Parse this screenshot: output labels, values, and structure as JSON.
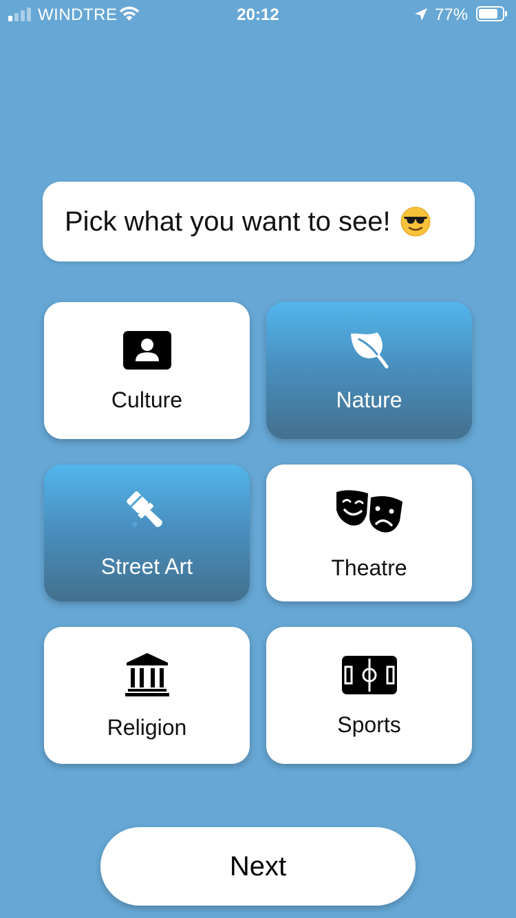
{
  "status_bar": {
    "carrier": "WINDTRE",
    "time": "20:12",
    "battery": "77%",
    "battery_level": 0.77,
    "icons": [
      "signal-icon",
      "wifi-icon",
      "location-arrow-icon",
      "battery-icon"
    ]
  },
  "prompt": {
    "text": "Pick what you want to see!",
    "emoji": "smiling-face-with-sunglasses"
  },
  "categories": [
    {
      "label": "Culture",
      "icon": "id-badge-icon",
      "selected": false
    },
    {
      "label": "Nature",
      "icon": "leaf-icon",
      "selected": true
    },
    {
      "label": "Street Art",
      "icon": "paint-brush-icon",
      "selected": true
    },
    {
      "label": "Theatre",
      "icon": "theater-masks-icon",
      "selected": false
    },
    {
      "label": "Religion",
      "icon": "landmark-icon",
      "selected": false
    },
    {
      "label": "Sports",
      "icon": "soccer-field-icon",
      "selected": false
    }
  ],
  "colors": {
    "background": "#66a7d5",
    "selected_top": "#52b6ec",
    "selected_bottom": "#43708f",
    "card": "#ffffff"
  },
  "actions": {
    "next_label": "Next"
  }
}
